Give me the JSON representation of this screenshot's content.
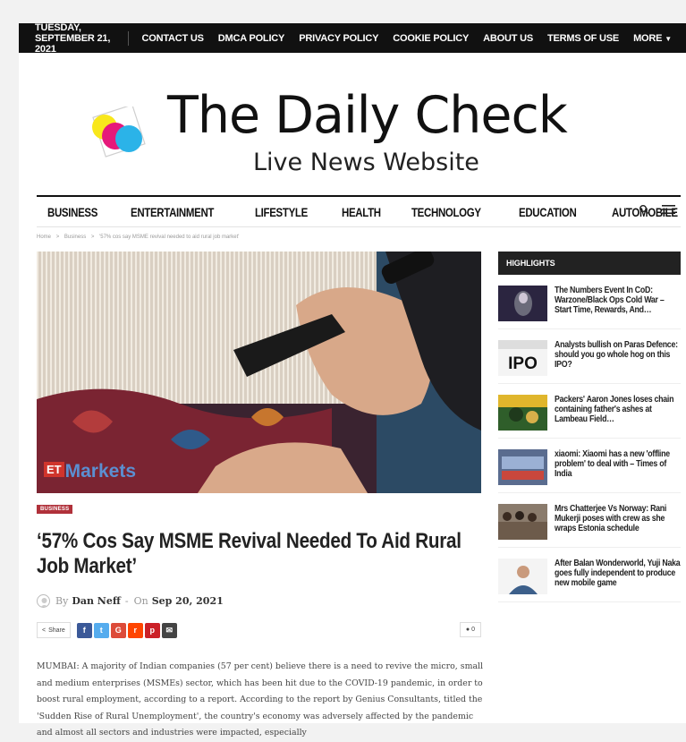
{
  "topbar": {
    "date": "TUESDAY, SEPTEMBER 21, 2021",
    "links": [
      "CONTACT US",
      "DMCA POLICY",
      "PRIVACY POLICY",
      "COOKIE POLICY",
      "ABOUT US",
      "TERMS OF USE"
    ],
    "more": "MORE"
  },
  "brand": {
    "title": "The Daily Check",
    "subtitle": "Live News Website"
  },
  "nav": {
    "items": [
      "BUSINESS",
      "ENTERTAINMENT",
      "LIFESTYLE",
      "HEALTH",
      "TECHNOLOGY",
      "EDUCATION",
      "AUTOMOBILE"
    ],
    "icons": [
      "search-icon",
      "menu-icon"
    ]
  },
  "breadcrumb": {
    "home": "Home",
    "section": "Business",
    "current": "'57% cos say MSME revival needed to aid rural job market'",
    "separator": ">"
  },
  "hero": {
    "watermark_prefix": "ET",
    "watermark": "Markets"
  },
  "article": {
    "category": "BUSINESS",
    "title": "‘57% Cos Say MSME Revival Needed To Aid Rural Job Market’",
    "by_label": "By",
    "author": "Dan Neff",
    "dash": "-",
    "on_label": "On",
    "date": "Sep 20, 2021",
    "share_label": "Share",
    "comment_count": "0",
    "body": "MUMBAI: A majority of Indian companies (57 per cent) believe there is a need to revive the micro, small and medium enterprises (MSMEs) sector, which has been hit due to the COVID-19 pandemic, in order to boost rural employment, according to a report. According to the report by Genius Consultants, titled the 'Sudden Rise of Rural Unemployment', the country's economy was adversely affected by the pandemic and almost all sectors and industries were impacted, especially"
  },
  "share_buttons": [
    {
      "name": "facebook-icon",
      "glyph": "f",
      "color": "#3b5998"
    },
    {
      "name": "twitter-icon",
      "glyph": "t",
      "color": "#55acee"
    },
    {
      "name": "google-icon",
      "glyph": "G",
      "color": "#dd4b39"
    },
    {
      "name": "reddit-icon",
      "glyph": "r",
      "color": "#ff4500"
    },
    {
      "name": "pinterest-icon",
      "glyph": "p",
      "color": "#cb2027"
    },
    {
      "name": "email-icon",
      "glyph": "✉",
      "color": "#444444"
    }
  ],
  "sidebar": {
    "heading": "HIGHLIGHTS",
    "items": [
      {
        "title": "The Numbers Event In CoD: Warzone/Black Ops Cold War – Start Time, Rewards, And…",
        "thumb": "game-thumb"
      },
      {
        "title": "Analysts bullish on Paras Defence: should you go whole hog on this IPO?",
        "thumb": "ipo-thumb",
        "thumb_text": "IPO"
      },
      {
        "title": "Packers' Aaron Jones loses chain containing father's ashes at Lambeau Field…",
        "thumb": "football-thumb"
      },
      {
        "title": "xiaomi: Xiaomi has a new 'offline problem' to deal with – Times of India",
        "thumb": "store-thumb"
      },
      {
        "title": "Mrs Chatterjee Vs Norway: Rani Mukerji poses with crew as she wraps Estonia schedule",
        "thumb": "crew-thumb"
      },
      {
        "title": "After Balan Wonderworld, Yuji Naka goes fully independent to produce new mobile game",
        "thumb": "portrait-thumb"
      }
    ]
  },
  "colors": {
    "topbar": "#111111",
    "category_badge": "#b0313a",
    "sidebar_head": "#222222"
  }
}
